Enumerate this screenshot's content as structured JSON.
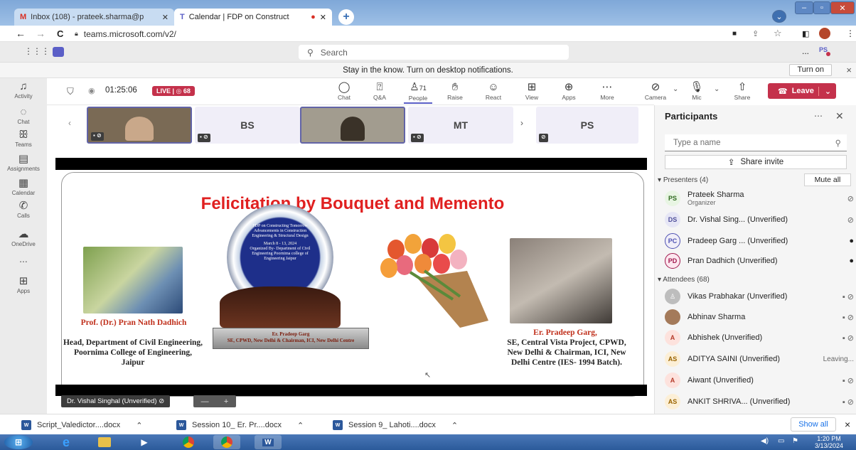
{
  "browser": {
    "tabs": [
      {
        "label": "Inbox (108) - prateek.sharma@p",
        "icon": "gmail-icon"
      },
      {
        "label": "Calendar | FDP on Construct",
        "icon": "teams-icon",
        "active": true
      }
    ],
    "new_tab": "+",
    "url": "teams.microsoft.com/v2/"
  },
  "teams": {
    "search_placeholder": "Search",
    "user_initials": "PS",
    "more": "...",
    "notification": "Stay in the know. Turn on desktop notifications.",
    "turn_on": "Turn on",
    "notification_close": "×"
  },
  "rail": [
    {
      "label": "Activity",
      "icon": "bell-icon"
    },
    {
      "label": "Chat",
      "icon": "chat-icon"
    },
    {
      "label": "Teams",
      "icon": "teams-group-icon"
    },
    {
      "label": "Assignments",
      "icon": "assignments-icon"
    },
    {
      "label": "Calendar",
      "icon": "calendar-icon"
    },
    {
      "label": "Calls",
      "icon": "phone-icon"
    },
    {
      "label": "OneDrive",
      "icon": "cloud-icon"
    },
    {
      "label": "...",
      "icon": "more-icon"
    },
    {
      "label": "Apps",
      "icon": "apps-icon"
    }
  ],
  "meeting": {
    "timer": "01:25:06",
    "live": "LIVE | ◎ 68",
    "participants_count": "71",
    "toolbar": [
      {
        "label": "Chat",
        "icon": "chat-icon"
      },
      {
        "label": "Q&A",
        "icon": "qa-icon"
      },
      {
        "label": "People",
        "icon": "people-icon"
      },
      {
        "label": "Raise",
        "icon": "hand-icon"
      },
      {
        "label": "React",
        "icon": "smile-icon"
      },
      {
        "label": "View",
        "icon": "grid-icon"
      },
      {
        "label": "Apps",
        "icon": "add-icon"
      },
      {
        "label": "More",
        "icon": "more-icon"
      }
    ],
    "devices": [
      {
        "label": "Camera",
        "icon": "camera-off-icon"
      },
      {
        "label": "Mic",
        "icon": "mic-off-icon"
      },
      {
        "label": "Share",
        "icon": "share-icon"
      }
    ],
    "leave": "Leave",
    "thumbnails": [
      {
        "initials": "",
        "video": true
      },
      {
        "initials": "BS",
        "video": false
      },
      {
        "initials": "",
        "video": true
      },
      {
        "initials": "MT",
        "video": false
      },
      {
        "initials": "PS",
        "video": false
      }
    ],
    "speaker_label": "Dr. Vishal Singhal (Unverified)",
    "stage_controls": "— +"
  },
  "slide": {
    "title": "Felicitation by Bouquet and Memento",
    "memento_text": "FDP on Constructing Tomorrow Advancements in Construction Engineering & Structural Design",
    "memento_date": "March 8 - 13, 2024",
    "memento_org": "Organized By- Department of Civil Engineering Poornima college of Engineering Jaipur",
    "memento_plate_name": "Er. Pradeep Garg",
    "memento_plate_role": "SE, CPWD, New Delhi & Chairman, ICI, New Delhi Centre",
    "left_name": "Prof. (Dr.) Pran Nath Dadhich",
    "left_desc": "Head, Department of Civil Engineering, Poornima College of Engineering, Jaipur",
    "right_name": "Er. Pradeep Garg,",
    "right_desc": "SE, Central Vista Project, CPWD, New Delhi & Chairman, ICI, New Delhi Centre (IES- 1994 Batch)."
  },
  "participants": {
    "title": "Participants",
    "search_placeholder": "Type a name",
    "share_invite": "Share invite",
    "presenters_header": "Presenters (4)",
    "mute_all": "Mute all",
    "attendees_header": "Attendees (68)",
    "presenters": [
      {
        "initials": "PS",
        "name": "Prateek Sharma",
        "role": "Organizer",
        "bg": "#e8f5e3",
        "fg": "#2f6a1f"
      },
      {
        "initials": "DS",
        "name": "Dr. Vishal Sing... (Unverified)",
        "role": "",
        "bg": "#e6e6f5",
        "fg": "#4f4f9a"
      },
      {
        "initials": "PC",
        "name": "Pradeep Garg ... (Unverified)",
        "role": "",
        "bg": "#f0eef8",
        "fg": "#4f52b2"
      },
      {
        "initials": "PD",
        "name": "Pran Dadhich (Unverified)",
        "role": "",
        "bg": "#fde7ef",
        "fg": "#a0184d"
      }
    ],
    "attendees": [
      {
        "initials": "",
        "name": "Vikas Prabhakar (Unverified)",
        "status": "",
        "bg": "#bdbdbd",
        "fg": "#fff"
      },
      {
        "initials": "",
        "name": "Abhinav Sharma",
        "status": "",
        "bg": "#a47a5a",
        "fg": "#fff"
      },
      {
        "initials": "A",
        "name": "Abhishek (Unverified)",
        "status": "",
        "bg": "#fde2dd",
        "fg": "#b53b2a"
      },
      {
        "initials": "AS",
        "name": "ADITYA SAINI (Unverified)",
        "status": "Leaving...",
        "bg": "#fcefd6",
        "fg": "#9a6400"
      },
      {
        "initials": "A",
        "name": "Aiwant (Unverified)",
        "status": "",
        "bg": "#fde2dd",
        "fg": "#b53b2a"
      },
      {
        "initials": "AS",
        "name": "ANKIT SHRIVA... (Unverified)",
        "status": "",
        "bg": "#fcefd6",
        "fg": "#9a6400"
      }
    ]
  },
  "downloads": {
    "items": [
      "Script_Valedictor....docx",
      "Session 10_ Er. Pr....docx",
      "Session 9_ Lahoti....docx"
    ],
    "show_all": "Show all",
    "close": "×"
  },
  "taskbar": {
    "time": "1:20 PM",
    "date": "3/13/2024"
  },
  "colors": {
    "teams_purple": "#6264a7",
    "leave_red": "#c4314b",
    "title_red": "#e02020"
  }
}
